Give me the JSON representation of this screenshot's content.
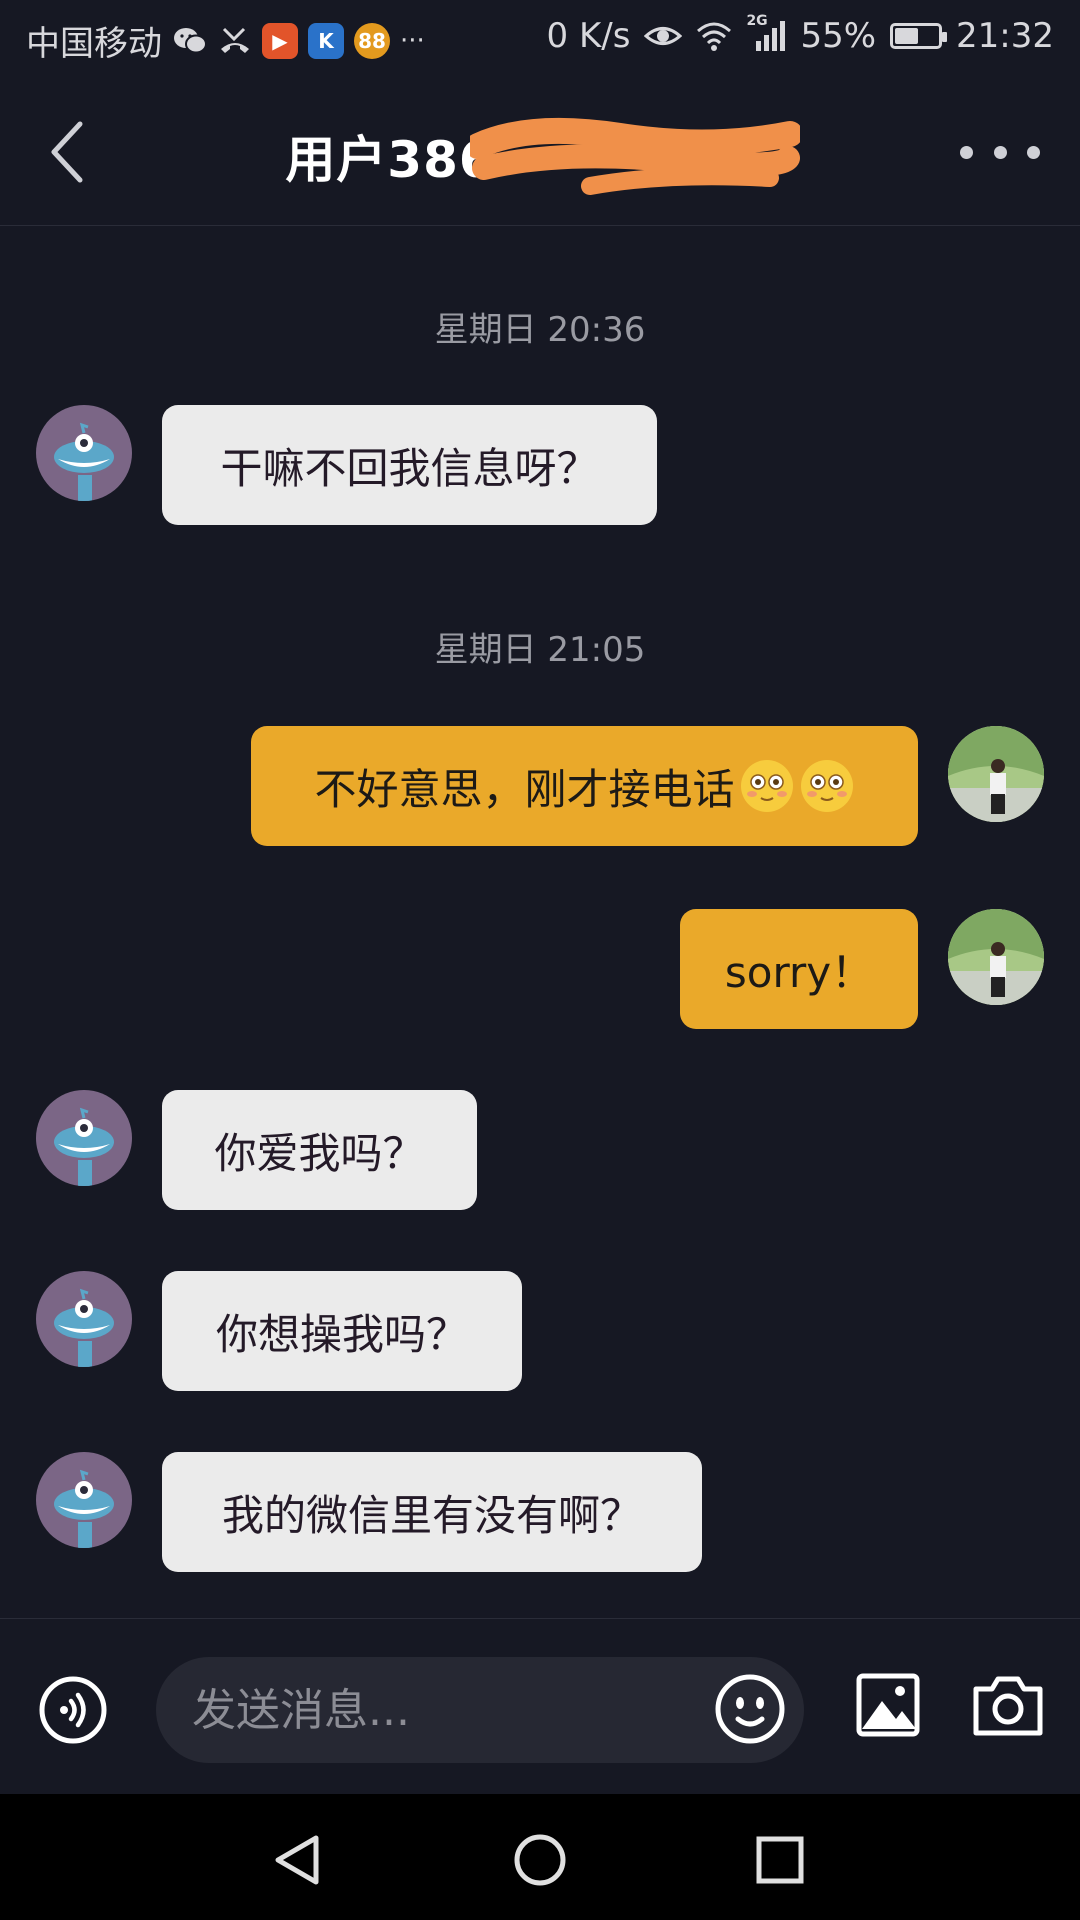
{
  "status_bar": {
    "carrier": "中国移动",
    "net_speed": "0 K/s",
    "signal_type": "2G",
    "battery": "55%",
    "battery_level": 0.55,
    "time": "21:32",
    "overflow": "···"
  },
  "header": {
    "title": "用户386",
    "back_icon": "chevron-left-icon",
    "more_icon": "more-dots-icon"
  },
  "messages": [
    {
      "type": "timestamp",
      "text": "星期日 20:36"
    },
    {
      "type": "incoming",
      "text": "干嘛不回我信息呀？"
    },
    {
      "type": "timestamp",
      "text": "星期日 21:05"
    },
    {
      "type": "outgoing",
      "text": "不好意思，刚才接电话",
      "emoji": "blushing-face-emoji"
    },
    {
      "type": "outgoing",
      "text": "sorry！"
    },
    {
      "type": "incoming",
      "text": "你爱我吗？"
    },
    {
      "type": "incoming",
      "text": "你想操我吗？"
    },
    {
      "type": "incoming",
      "text": "我的微信里有没有啊？"
    }
  ],
  "input_bar": {
    "placeholder": "发送消息..."
  },
  "colors": {
    "background": "#161823",
    "incoming_bubble": "#ebebeb",
    "outgoing_bubble": "#eaa92a",
    "timestamp": "#9a9ba3"
  }
}
